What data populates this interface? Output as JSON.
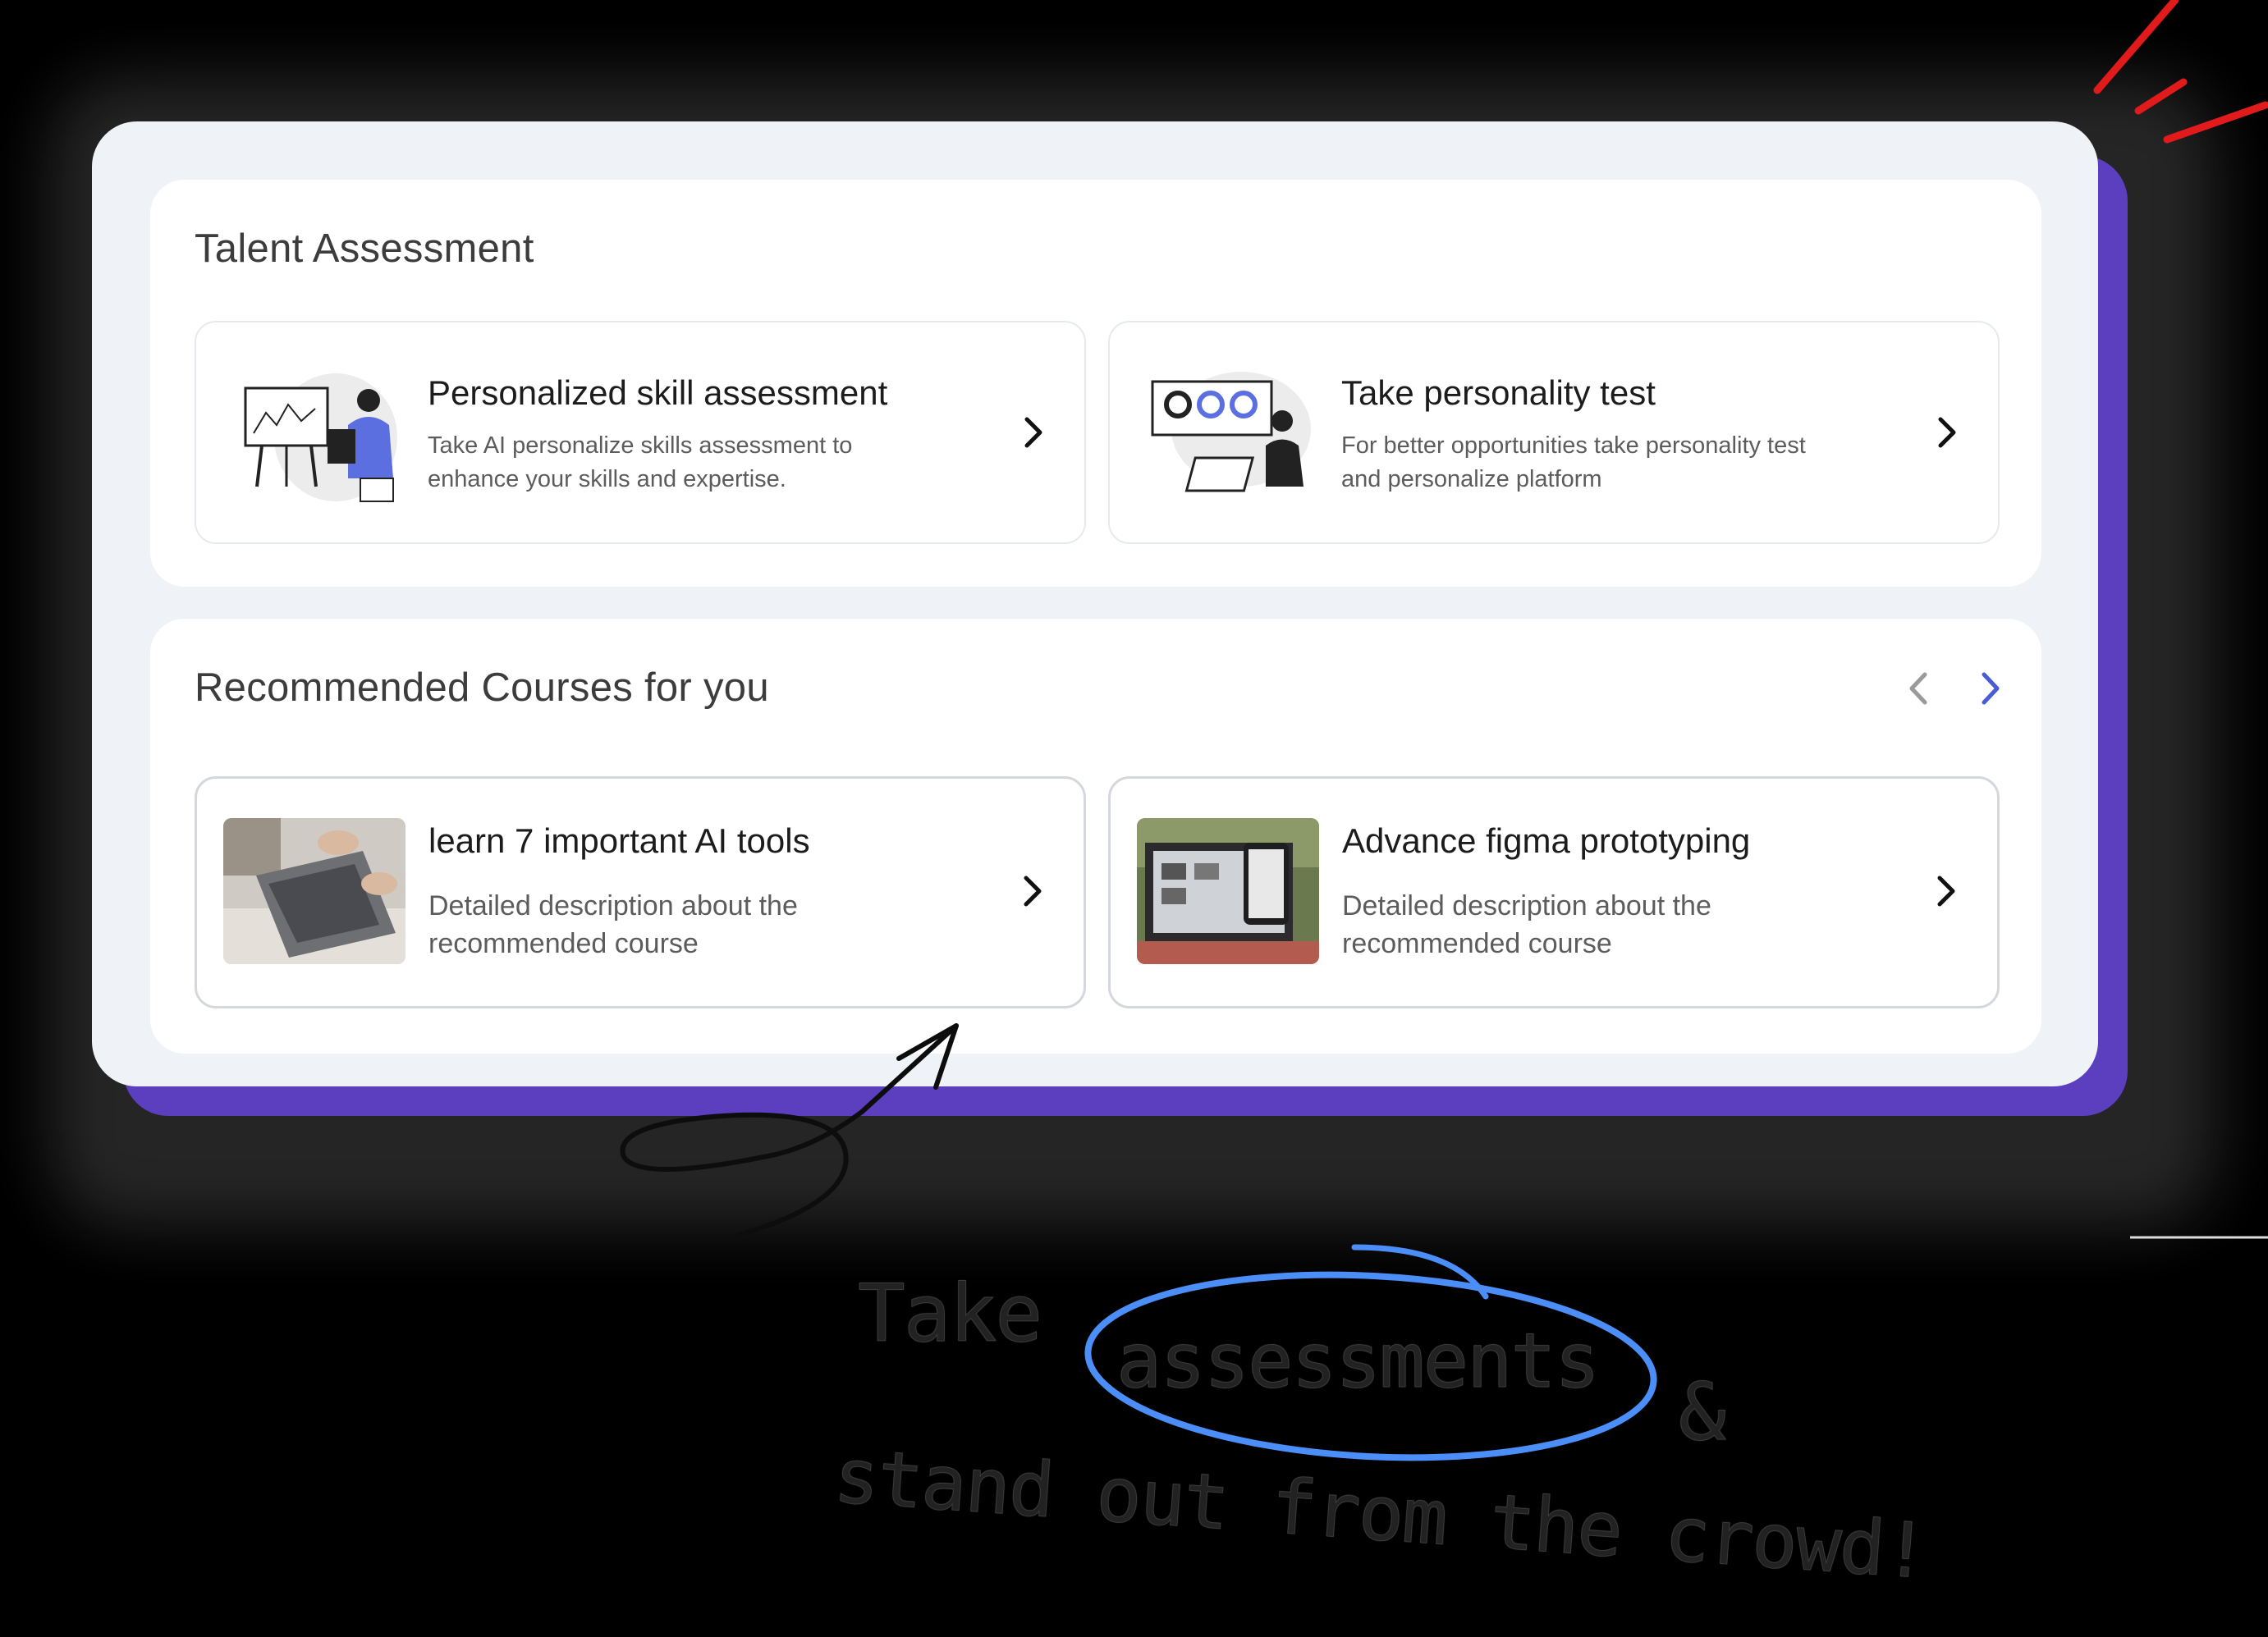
{
  "talent_assessment": {
    "title": "Talent Assessment",
    "cards": [
      {
        "title": "Personalized skill assessment",
        "description": "Take AI personalize skills assessment to enhance your skills and expertise.",
        "illustration": "presenter-illustration",
        "action_icon": "chevron-right-icon"
      },
      {
        "title": "Take personality test",
        "description": "For better opportunities take personality test and personalize platform",
        "illustration": "analytics-illustration",
        "action_icon": "chevron-right-icon"
      }
    ]
  },
  "recommended": {
    "title": "Recommended Courses for you",
    "nav": {
      "prev_icon": "chevron-left-icon",
      "next_icon": "chevron-right-icon"
    },
    "courses": [
      {
        "title": "learn 7 important AI tools",
        "description": "Detailed description about the recommended  course",
        "thumbnail": "laptop-photo",
        "action_icon": "chevron-right-icon"
      },
      {
        "title": "Advance figma prototyping",
        "description": "Detailed description about the recommended  course",
        "thumbnail": "figma-laptop-photo",
        "action_icon": "chevron-right-icon"
      }
    ]
  },
  "annotation": {
    "line1_start": "Take",
    "line1_circled": "assessments",
    "line1_end": "&",
    "line2": "stand out from the crowd!"
  },
  "colors": {
    "accent": "#5b3fbf",
    "nav_active": "#4a5bd6",
    "circle": "#4c8ef7",
    "burst": "#e11b1b"
  }
}
